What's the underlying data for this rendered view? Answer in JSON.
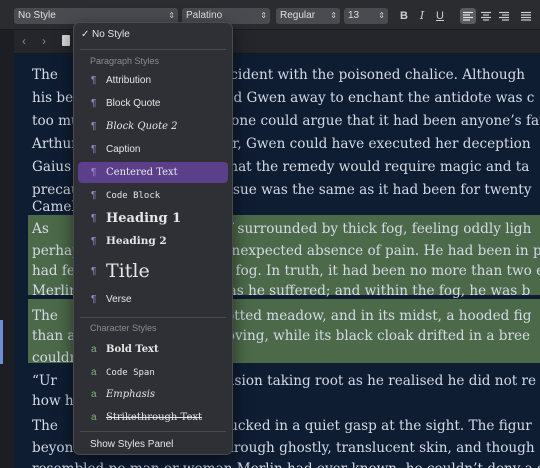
{
  "toolbar": {
    "style_select": "No Style",
    "font_select": "Palatino",
    "weight_select": "Regular",
    "size_select": "13",
    "bold": "B",
    "italic": "I",
    "underline": "U",
    "align_active": "left"
  },
  "popup": {
    "no_style": "No Style",
    "paragraph_header": "Paragraph Styles",
    "paragraph_styles": [
      "Attribution",
      "Block Quote",
      "Block Quote 2",
      "Caption",
      "Centered Text",
      "Code Block",
      "Heading 1",
      "Heading 2",
      "Title",
      "Verse"
    ],
    "character_header": "Character Styles",
    "character_styles": [
      "Bold Text",
      "Code Span",
      "Emphasis",
      "Strikethrough Text"
    ],
    "show_panel": "Show Styles Panel",
    "paragraph_icon": "¶",
    "character_icon": "a"
  },
  "editor": {
    "lines": [
      "The                                  e incident with the poisoned chalice. Although",
      "his bes                              send Gwen away to enchant the antidote was c",
      "too mu                               in one could argue that it had been anyone’s fau",
      "Arthur                              oner, Gwen could have executed her deception",
      "Gaius                               er that the remedy would require magic and ta",
      "precau                              e issue was the same as it had been for twenty",
      "Camel",
      "As                                   nself surrounded by thick fog, feeling oddly ligh",
      "perhap                              e unexpected absence of pain. He had been in pa",
      "had fe                               the fog. In truth, it had been no more than two e",
      "Merlin                              ne as he suffered; and within the fog, he was b",
      "The                                  e-dotted meadow, and in its midst, a hooded fig",
      "than a                              nmoving, while its black cloak drifted in a bree",
      "couldn",
      "“Ur                                  onfusion taking root as he realised he did not re",
      "how h",
      "The                                  in sucked in a quiet gasp at the sight. The figur",
      "beyon                               e through ghostly, translucent skin, and though",
      "resembled no man or woman Merlin had ever known, he couldn’t deny a sens"
    ]
  }
}
